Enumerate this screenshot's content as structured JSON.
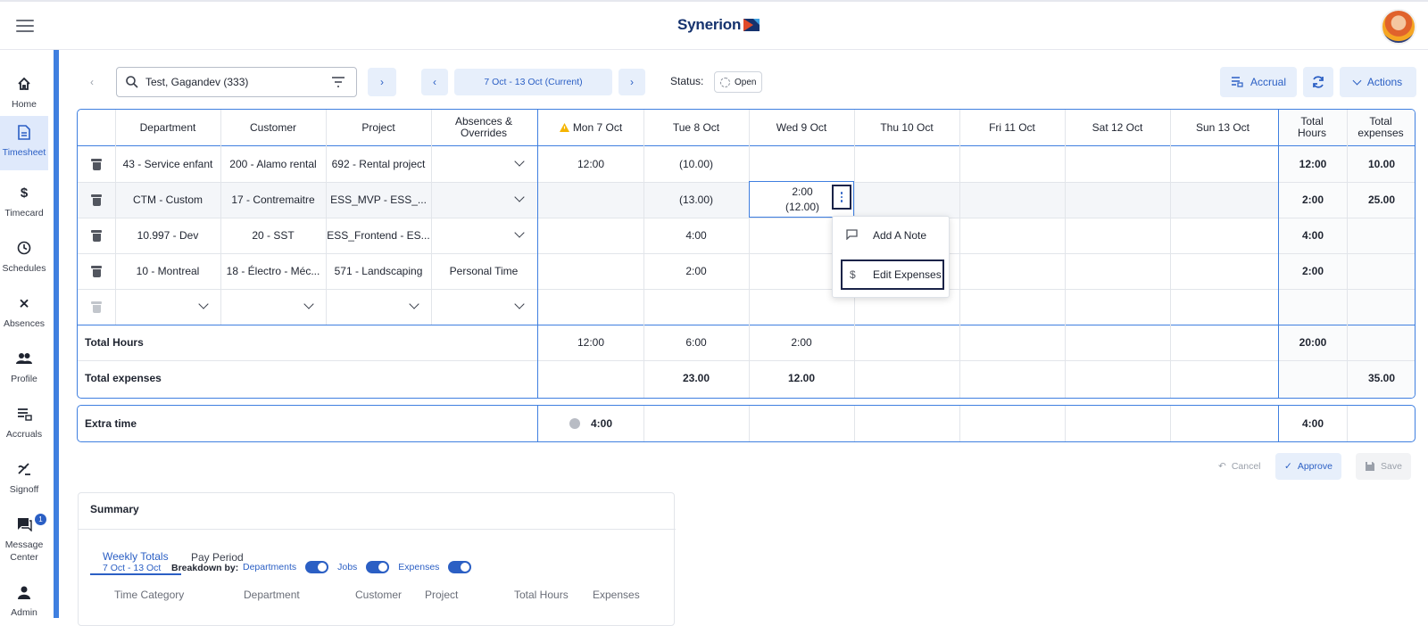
{
  "app": {
    "brand": "Synerion"
  },
  "sidebar": {
    "items": [
      {
        "label": "Home",
        "icon": "home-icon"
      },
      {
        "label": "Timesheet",
        "icon": "document-icon"
      },
      {
        "label": "Timecard",
        "icon": "dollar-icon"
      },
      {
        "label": "Schedules",
        "icon": "clock-icon"
      },
      {
        "label": "Absences",
        "icon": "person-x-icon"
      },
      {
        "label": "Profile",
        "icon": "people-icon"
      },
      {
        "label": "Accruals",
        "icon": "accruals-icon"
      },
      {
        "label": "Signoff",
        "icon": "signoff-icon"
      },
      {
        "label": "Message Center",
        "icon": "chat-icon",
        "badge": "1"
      },
      {
        "label": "Admin",
        "icon": "person-icon"
      }
    ]
  },
  "toolbar": {
    "employee_value": "Test, Gagandev (333)",
    "period_label": "7 Oct - 13 Oct (Current)",
    "status_label": "Status:",
    "status_value": "Open",
    "accrual_label": "Accrual",
    "actions_label": "Actions"
  },
  "grid": {
    "headers": {
      "department": "Department",
      "customer": "Customer",
      "project": "Project",
      "absences": "Absences & Overrides",
      "days": [
        "Mon 7 Oct",
        "Tue 8 Oct",
        "Wed 9 Oct",
        "Thu 10 Oct",
        "Fri 11 Oct",
        "Sat 12 Oct",
        "Sun 13 Oct"
      ],
      "total_hours": "Total Hours",
      "total_expenses": "Total expenses"
    },
    "rows": [
      {
        "department": "43 - Service enfant",
        "customer": "200 - Alamo rental",
        "project": "692 - Rental project",
        "absence": "",
        "days": [
          "12:00",
          "(10.00)",
          "",
          "",
          "",
          "",
          ""
        ],
        "total_hours": "12:00",
        "total_expenses": "10.00"
      },
      {
        "department": "CTM - Custom",
        "customer": "17 - Contremaitre",
        "project": "ESS_MVP - ESS_...",
        "absence": "",
        "days": [
          "",
          "(13.00)",
          "2:00|(12.00)",
          "",
          "",
          "",
          ""
        ],
        "total_hours": "2:00",
        "total_expenses": "25.00"
      },
      {
        "department": "10.997 - Dev",
        "customer": "20 - SST",
        "project": "ESS_Frontend - ES...",
        "absence": "",
        "days": [
          "",
          "4:00",
          "",
          "",
          "",
          "",
          ""
        ],
        "total_hours": "4:00",
        "total_expenses": ""
      },
      {
        "department": "10 - Montreal",
        "customer": "18 - Électro - Méc...",
        "project": "571 - Landscaping",
        "absence": "Personal Time",
        "days": [
          "",
          "2:00",
          "",
          "",
          "",
          "",
          ""
        ],
        "total_hours": "2:00",
        "total_expenses": ""
      }
    ],
    "wed_row2_hours": "2:00",
    "wed_row2_expense": "(12.00)",
    "totals": {
      "hours_label": "Total Hours",
      "hours": [
        "12:00",
        "6:00",
        "2:00",
        "",
        "",
        "",
        ""
      ],
      "hours_total": "20:00",
      "expenses_label": "Total expenses",
      "expenses": [
        "",
        "23.00",
        "12.00",
        "",
        "",
        "",
        ""
      ],
      "expenses_total": "35.00"
    }
  },
  "context_menu": {
    "add_note": "Add A Note",
    "edit_expenses": "Edit Expenses"
  },
  "extra_time": {
    "label": "Extra time",
    "mon_value": "4:00",
    "total": "4:00"
  },
  "footer_actions": {
    "cancel": "Cancel",
    "approve": "Approve",
    "save": "Save"
  },
  "summary": {
    "title": "Summary",
    "tabs": [
      "Weekly Totals",
      "Pay Period"
    ],
    "range": "7 Oct - 13 Oct",
    "breakdown_label": "Breakdown by:",
    "toggles": [
      "Departments",
      "Jobs",
      "Expenses"
    ],
    "columns": [
      "Time Category",
      "Department",
      "Customer",
      "Project",
      "Total Hours",
      "Expenses"
    ]
  },
  "colors": {
    "accent": "#2b5fc4",
    "rail": "#3f7fe0",
    "chip_bg": "#e7effb",
    "brand_navy": "#15326e",
    "warning": "#f5b400"
  }
}
